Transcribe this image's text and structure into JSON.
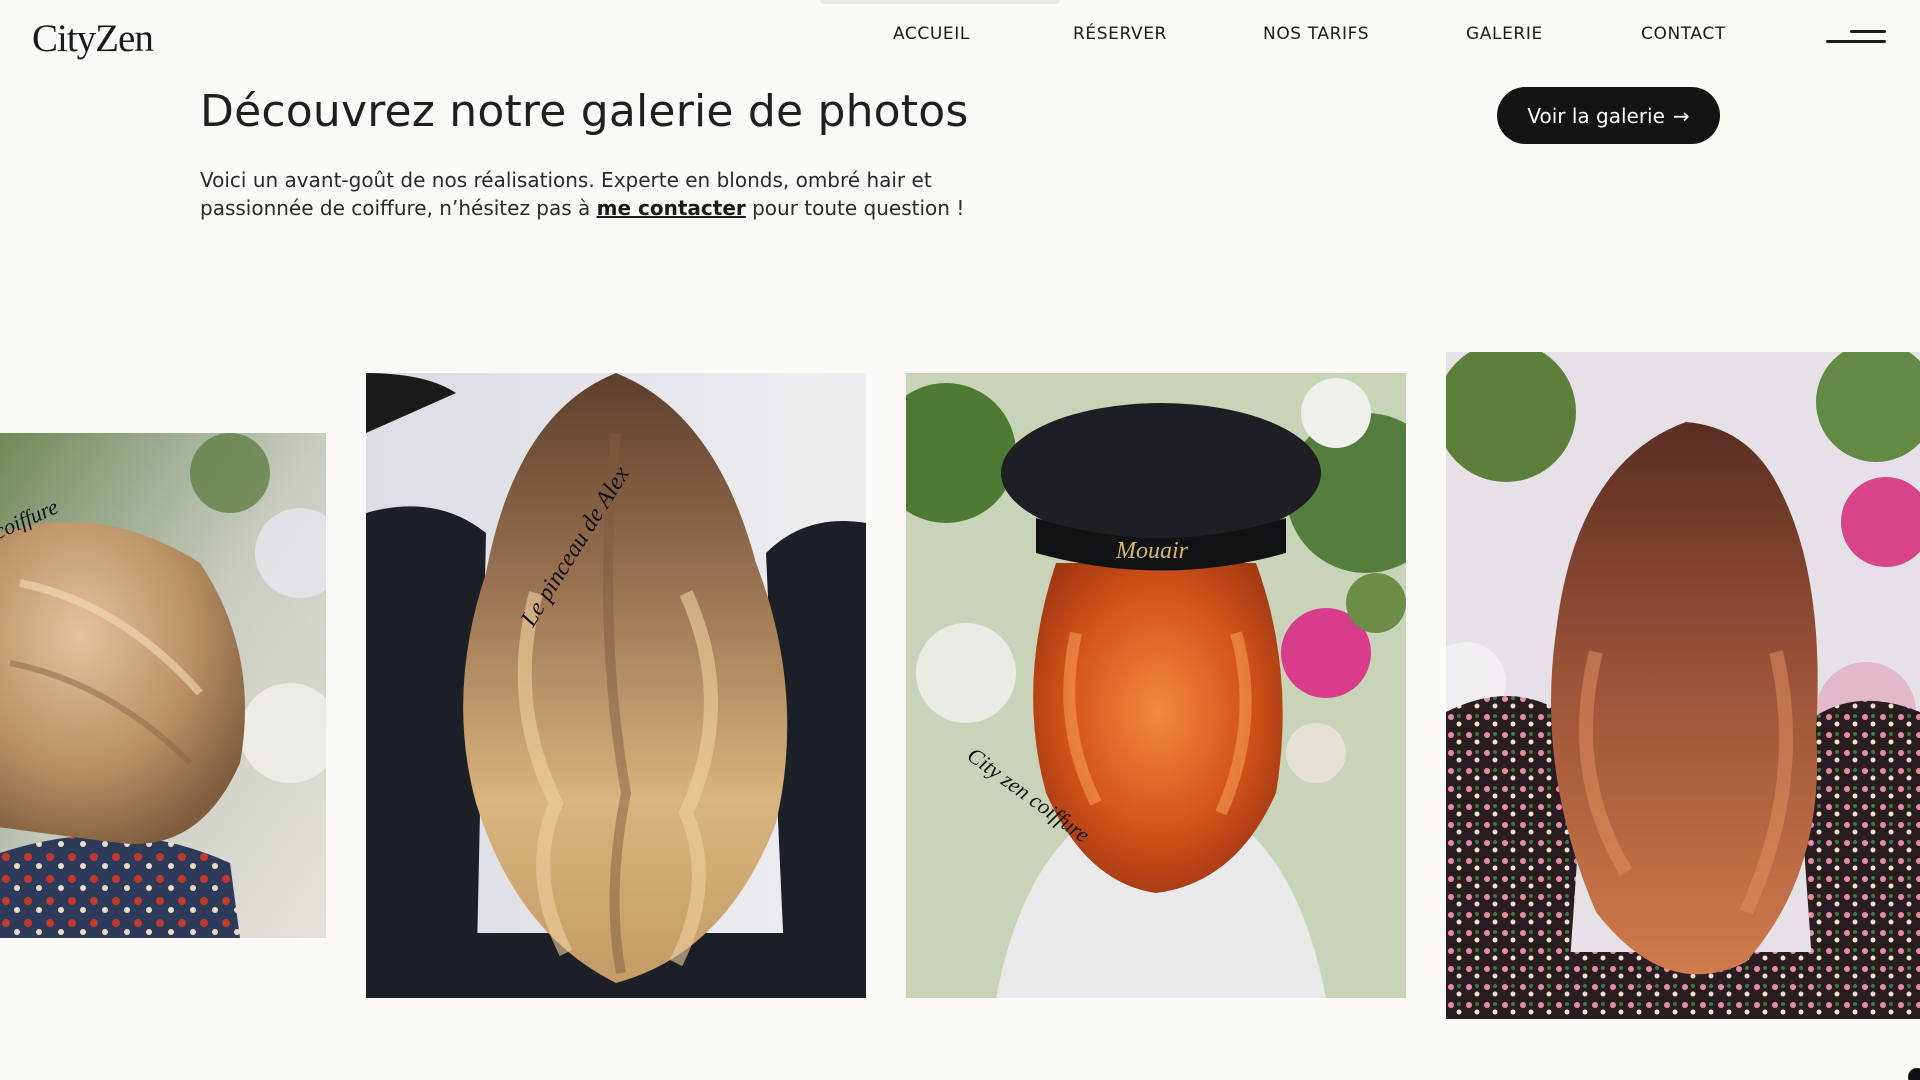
{
  "brand": {
    "logo": "CityZen"
  },
  "nav": {
    "items": [
      {
        "label": "ACCUEIL"
      },
      {
        "label": "RÉSERVER"
      },
      {
        "label": "NOS TARIFS"
      },
      {
        "label": "GALERIE"
      },
      {
        "label": "CONTACT"
      }
    ],
    "menu_icon": "menu-icon"
  },
  "intro": {
    "title": "Découvrez notre galerie de photos",
    "text_before": "Voici un avant-goût de nos réalisations. Experte en blonds, ombré hair et passionnée de coiffure, n’hésitez pas à ",
    "link": "me contacter",
    "text_after": " pour toute question !",
    "cta_label": "Voir la galerie",
    "cta_icon": "arrow-right-icon"
  },
  "gallery": {
    "photos": [
      {
        "subject": "blonde bob haircut",
        "watermark": "coiffure"
      },
      {
        "subject": "long wavy balayage",
        "watermark": "Le pinceau de Alex"
      },
      {
        "subject": "copper waves with beret",
        "watermark": "City zen coiffure",
        "beret_text": "Mouair"
      },
      {
        "subject": "auburn ombré waves",
        "watermark": ""
      }
    ]
  },
  "colors": {
    "background": "#fbfaf7",
    "text": "#1a1a1a",
    "cta_background": "#141414",
    "cta_text": "#ffffff"
  }
}
